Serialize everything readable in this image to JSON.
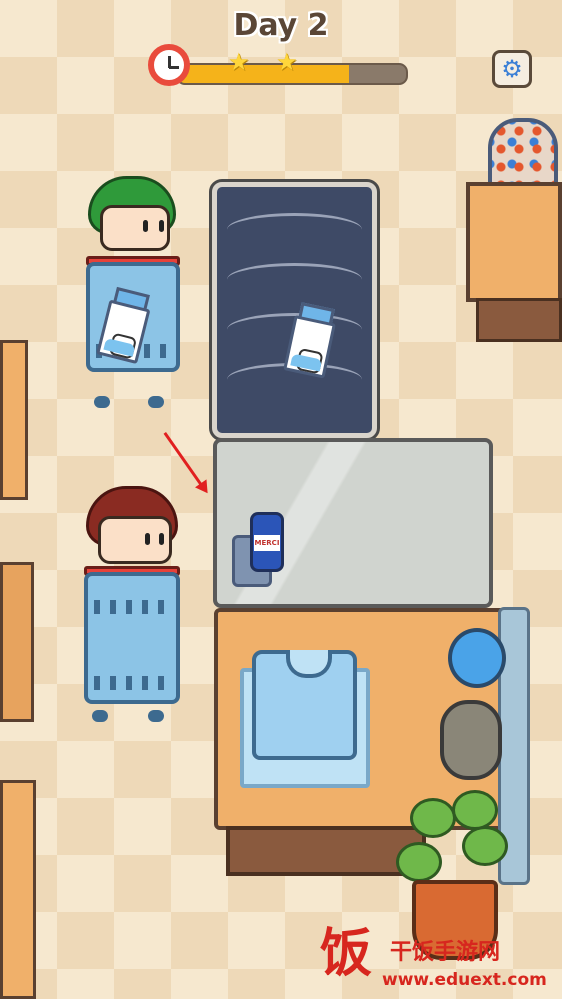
{
  "hud": {
    "day_label": "Day 2",
    "progress": 0.75,
    "stars_earned": 2,
    "settings_icon": "gear-icon",
    "timer_icon": "alarm-clock-icon"
  },
  "items": {
    "conveyor_item": "milk-carton",
    "scanner_item_label": "MERCI"
  },
  "watermark": {
    "logo": "饭",
    "name": "干饭手游网",
    "url": "www.eduext.com"
  },
  "colors": {
    "accent": "#f5b31a",
    "arrow": "#e12020",
    "settings": "#3b7fd6"
  }
}
